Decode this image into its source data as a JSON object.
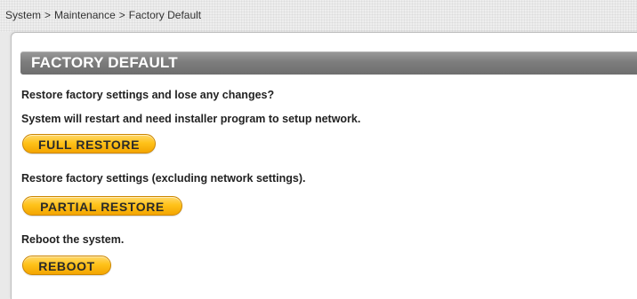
{
  "breadcrumb": {
    "items": [
      "System",
      "Maintenance",
      "Factory Default"
    ],
    "separator": ">"
  },
  "section": {
    "title": "FACTORY DEFAULT"
  },
  "messages": {
    "restore_question": "Restore factory settings and lose any changes?",
    "restart_note": "System will restart and need installer program to setup network.",
    "partial_note": "Restore factory settings (excluding network settings).",
    "reboot_note": "Reboot the system."
  },
  "buttons": {
    "full_restore": "FULL RESTORE",
    "partial_restore": "PARTIAL RESTORE",
    "reboot": "REBOOT"
  },
  "colors": {
    "button_fill": "#ffc21a",
    "header_fill": "#7d7d7d"
  }
}
